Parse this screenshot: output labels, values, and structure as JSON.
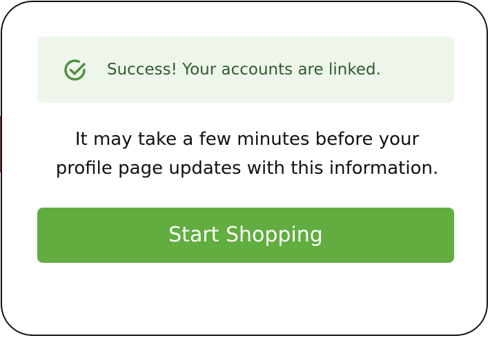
{
  "banner": {
    "icon": "check-circle-icon",
    "text": "Success! Your accounts are linked.",
    "background_color": "#eef6ec",
    "text_color": "#2f5b2b",
    "icon_color": "#4f8f3f"
  },
  "message": {
    "line1": "It may take a few minutes before your",
    "line2": "profile page updates with this information."
  },
  "button": {
    "label": "Start Shopping",
    "background_color": "#61ad3f",
    "text_color": "#ffffff"
  }
}
